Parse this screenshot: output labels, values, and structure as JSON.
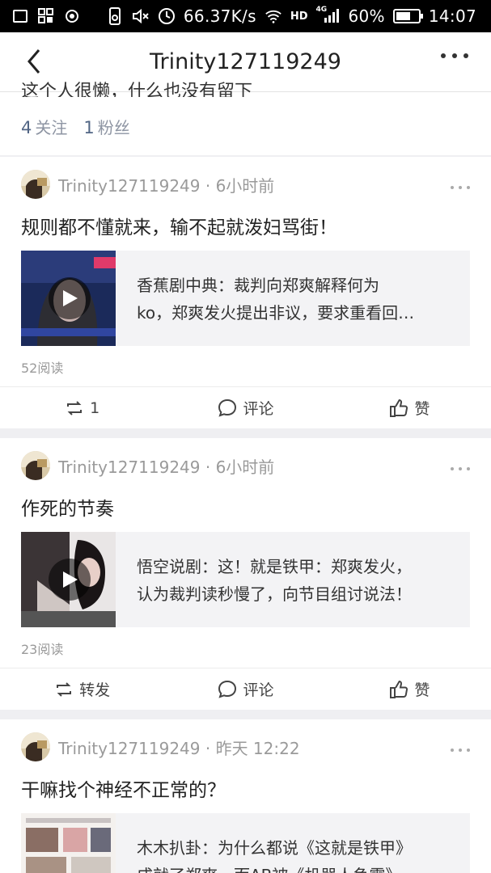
{
  "status_bar": {
    "network_speed": "66.37K/s",
    "hd_label": "HD",
    "signal_label": "4G",
    "battery": "60%",
    "time": "14:07"
  },
  "nav": {
    "title": "Trinity127119249"
  },
  "profile": {
    "bio_clipped": "这个人很懒，什么也没有留下",
    "following_count": "4",
    "following_label": "关注",
    "followers_count": "1",
    "followers_label": "粉丝"
  },
  "posts": [
    {
      "author": "Trinity127119249",
      "time": "6小时前",
      "text": "规则都不懂就来，输不起就泼妇骂街！",
      "card_line1": "香蕉剧中典：裁判向郑爽解释何为",
      "card_line2": "ko，郑爽发火提出非议，要求重看回…",
      "reads": "52阅读",
      "repost_label": "1",
      "comment_label": "评论",
      "like_label": "赞"
    },
    {
      "author": "Trinity127119249",
      "time": "6小时前",
      "text": "作死的节奏",
      "card_line1": "悟空说剧：这！就是铁甲：郑爽发火，",
      "card_line2": "认为裁判读秒慢了，向节目组讨说法！",
      "reads": "23阅读",
      "repost_label": "转发",
      "comment_label": "评论",
      "like_label": "赞"
    },
    {
      "author": "Trinity127119249",
      "time": "昨天 12:22",
      "text": "干嘛找个神经不正常的？",
      "card_line1": "木木扒卦：为什么都说《这就是铁甲》",
      "card_line2": "成就了郑爽，而AB被《机器人争霸》"
    }
  ],
  "colors": {
    "stat_number": "#526685",
    "meta_text": "#9a9a9a",
    "card_bg": "#f3f3f5",
    "page_bg": "#efeff2"
  }
}
